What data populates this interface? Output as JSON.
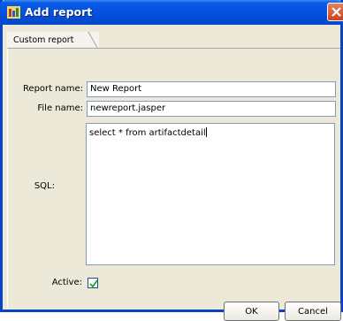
{
  "window": {
    "title": "Add report",
    "icon": "report-app-icon",
    "close_icon": "close-icon"
  },
  "tabs": [
    {
      "label": "Custom report",
      "active": true
    }
  ],
  "form": {
    "report_name_label": "Report name:",
    "report_name_value": "New Report",
    "file_name_label": "File name:",
    "file_name_value": "newreport.jasper",
    "sql_label": "SQL:",
    "sql_value": "select * from artifactdetail",
    "active_label": "Active:",
    "active_checked": true
  },
  "buttons": {
    "ok_label": "OK",
    "cancel_label": "Cancel"
  },
  "colors": {
    "titlebar": "#0650dc",
    "dialog_bg": "#ece9d8",
    "field_border": "#7f9db9",
    "check_mark": "#21a121",
    "close_button": "#c9431d"
  }
}
